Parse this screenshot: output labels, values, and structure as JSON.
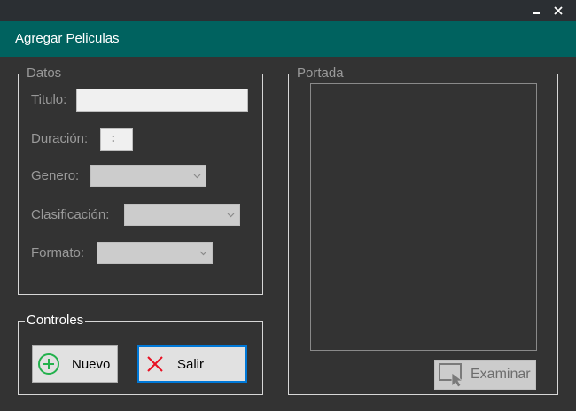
{
  "window": {
    "minimize_glyph": "_",
    "close_glyph": "✕"
  },
  "header": {
    "title": "Agregar Peliculas"
  },
  "datos": {
    "legend": "Datos",
    "titulo_label": "Titulo:",
    "titulo_value": "",
    "duracion_label": "Duración:",
    "duracion_mask": "_:__",
    "genero_label": "Genero:",
    "genero_value": "",
    "clasificacion_label": "Clasificación:",
    "clasificacion_value": "",
    "formato_label": "Formato:",
    "formato_value": ""
  },
  "controles": {
    "legend": "Controles",
    "nuevo_label": "Nuevo",
    "salir_label": "Salir"
  },
  "portada": {
    "legend": "Portada",
    "examinar_label": "Examinar"
  },
  "colors": {
    "header_bg": "#00625f",
    "body_bg": "#333333",
    "titlebar_bg": "#2b2f33",
    "plus_icon": "#22b14c",
    "close_icon": "#e81123",
    "focus_border": "#0078d7"
  },
  "icons": {
    "minimize": "minimize-icon",
    "close": "close-icon",
    "nuevo": "plus-circle-icon",
    "salir": "x-icon",
    "examinar": "select-cursor-icon",
    "dropdown": "chevron-down-icon"
  }
}
